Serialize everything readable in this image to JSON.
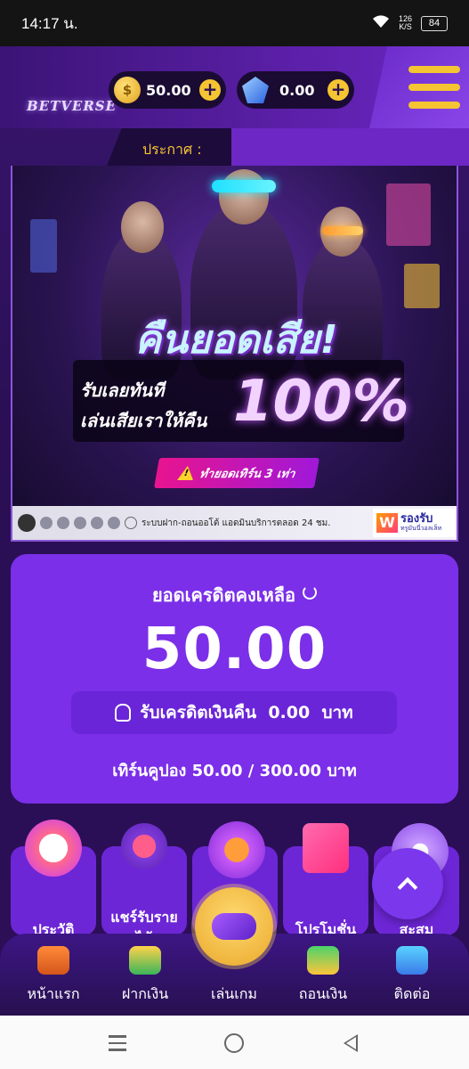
{
  "status_bar": {
    "time": "14:17 น.",
    "net_speed_value": "126",
    "net_speed_unit": "K/S",
    "battery": "84"
  },
  "header": {
    "logo_text": "BETVERSE",
    "coin_symbol": "$",
    "coin_balance": "50.00",
    "gem_balance": "0.00",
    "plus": "+"
  },
  "announcement": {
    "label": "ประกาศ :"
  },
  "banner": {
    "headline": "คืนยอดเสีย!",
    "line1": "รับเลยทันที",
    "line2": "เล่นเสียเราให้คืน",
    "percent": "100%",
    "warning": "ทำยอดเทิร์น 3 เท่า",
    "footer_text": "ระบบฝาก-ถอนออโต้ แอดมินบริการตลอด 24 ชม.",
    "footer_badge_1": "รองรับ",
    "footer_badge_2": "ทรูมันนี่วอลเล็ท",
    "footer_badge_logo": "W"
  },
  "credit": {
    "title": "ยอดเครดิตคงเหลือ",
    "value": "50.00",
    "cashback": "รับเครดิตเงินคืน  0.00  บาท",
    "turnover": "เทิร์นคูปอง 50.00 / 300.00 บาท"
  },
  "tiles": [
    {
      "label": "ประวัติ"
    },
    {
      "label_line1": "แชร์รับราย",
      "label_line2": "ได้"
    },
    {
      "label": ""
    },
    {
      "label": "โปรโมชั่น"
    },
    {
      "label": "สะสม"
    }
  ],
  "bottom_nav": [
    {
      "label": "หน้าแรก",
      "icon": "home-icon"
    },
    {
      "label": "ฝากเงิน",
      "icon": "deposit-icon"
    },
    {
      "label": "เล่นเกม",
      "icon": "gamepad-icon"
    },
    {
      "label": "ถอนเงิน",
      "icon": "withdraw-icon"
    },
    {
      "label": "ติดต่อ",
      "icon": "contact-icon"
    }
  ],
  "colors": {
    "primary": "#7b2fe8",
    "accent": "#f5c433",
    "background": "#2a0f55"
  }
}
